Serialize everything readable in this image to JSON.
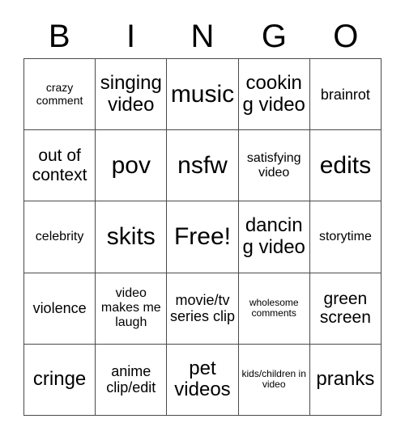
{
  "card": {
    "title": "BINGO",
    "header_letters": [
      "B",
      "I",
      "N",
      "G",
      "O"
    ],
    "free_space_label": "Free!",
    "rows": [
      [
        {
          "text": "crazy comment",
          "size": "xs"
        },
        {
          "text": "singing video",
          "size": "xl"
        },
        {
          "text": "music",
          "size": "xxl"
        },
        {
          "text": "cooking video",
          "size": "xl"
        },
        {
          "text": "brainrot",
          "size": "m"
        }
      ],
      [
        {
          "text": "out of context",
          "size": "l"
        },
        {
          "text": "pov",
          "size": "xxl"
        },
        {
          "text": "nsfw",
          "size": "xxl"
        },
        {
          "text": "satisfying video",
          "size": "s"
        },
        {
          "text": "edits",
          "size": "xxl"
        }
      ],
      [
        {
          "text": "celebrity",
          "size": "s"
        },
        {
          "text": "skits",
          "size": "xxl"
        },
        {
          "text": "Free!",
          "size": "xxl"
        },
        {
          "text": "dancing video",
          "size": "xl"
        },
        {
          "text": "storytime",
          "size": "s"
        }
      ],
      [
        {
          "text": "violence",
          "size": "m"
        },
        {
          "text": "video makes me laugh",
          "size": "s"
        },
        {
          "text": "movie/tv series clip",
          "size": "m"
        },
        {
          "text": "wholesome comments",
          "size": "xxs"
        },
        {
          "text": "green screen",
          "size": "l"
        }
      ],
      [
        {
          "text": "cringe",
          "size": "xl"
        },
        {
          "text": "anime clip/edit",
          "size": "m"
        },
        {
          "text": "pet videos",
          "size": "xl"
        },
        {
          "text": "kids/children in video",
          "size": "xxs"
        },
        {
          "text": "pranks",
          "size": "xl"
        }
      ]
    ]
  },
  "colors": {
    "background": "#ffffff",
    "text": "#000000",
    "grid_line": "#4a4a4a"
  }
}
